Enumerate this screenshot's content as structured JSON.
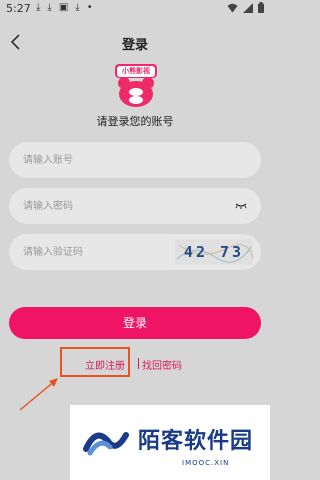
{
  "status_bar": {
    "time": "5:27",
    "notification_icons": [
      "download-icon",
      "download-icon",
      "app-icon",
      "download-icon",
      "dot-icon"
    ],
    "right_icons": [
      "wifi-icon",
      "signal-icon",
      "battery-icon"
    ]
  },
  "nav": {
    "title": "登录",
    "back_icon": "chevron-left-icon"
  },
  "logo": {
    "label": "小熊影视",
    "color": "#ee2a6b"
  },
  "subtitle": "请登录您的账号",
  "form": {
    "account_placeholder": "请输入账号",
    "password_placeholder": "请输入密码",
    "captcha_placeholder": "请输入验证码",
    "captcha_text": "42 73"
  },
  "login_label": "登录",
  "links": {
    "register": "立即注册",
    "forgot": "找回密码"
  },
  "watermark": {
    "name": "陌客软件园",
    "sub": "IMOOC.XIN"
  },
  "colors": {
    "accent": "#f01465",
    "link": "#d81b5e",
    "highlight": "#e8541e",
    "background": "#d6d6d6",
    "field": "#e7e7e7"
  }
}
